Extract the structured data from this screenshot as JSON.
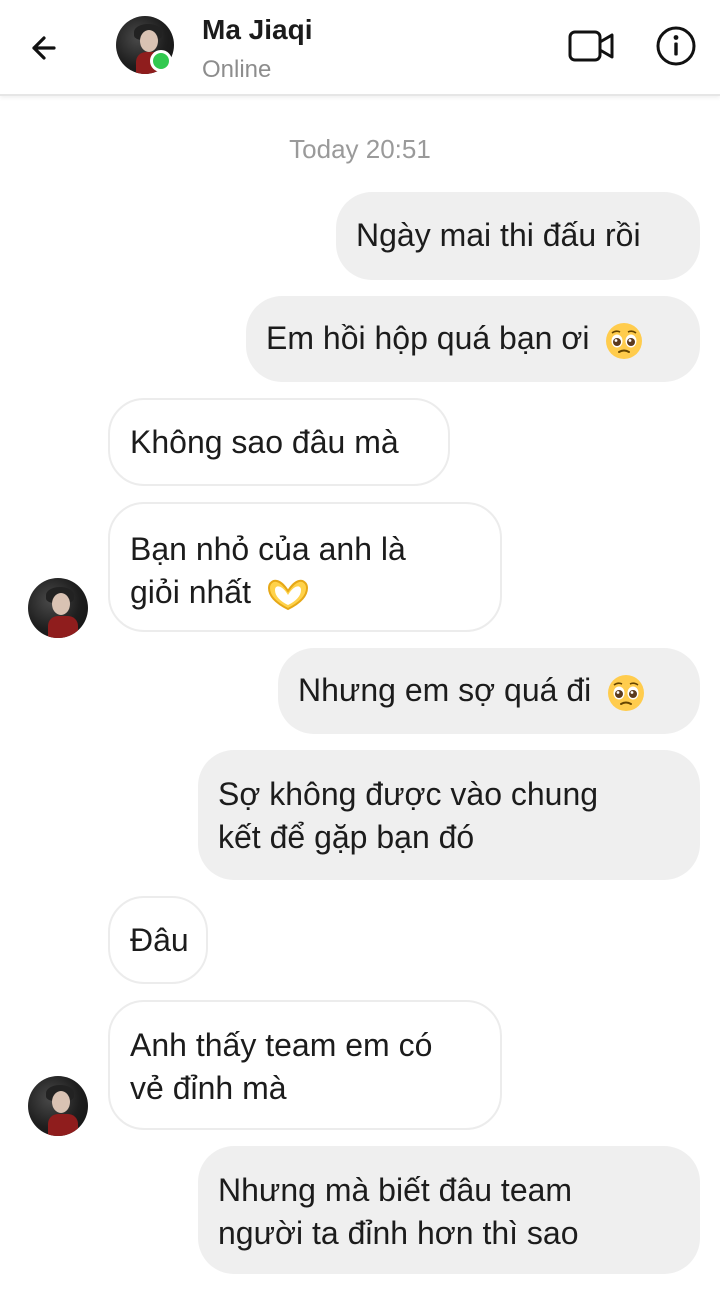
{
  "header": {
    "contact_name": "Ma Jiaqi",
    "status": "Online"
  },
  "conversation": {
    "timestamp": "Today 20:51",
    "messages": [
      {
        "sender": "me",
        "text": "Ngày mai thi đấu rồi",
        "emoji": ""
      },
      {
        "sender": "me",
        "text": "Em hồi hộp quá bạn ơi",
        "emoji": "pleading-face"
      },
      {
        "sender": "them",
        "text": "Không sao đâu mà",
        "emoji": ""
      },
      {
        "sender": "them",
        "line1": "Bạn nhỏ của anh là",
        "line2": "giỏi nhất",
        "emoji": "heart-hands"
      },
      {
        "sender": "me",
        "text": "Nhưng em sợ quá đi",
        "emoji": "pleading-face"
      },
      {
        "sender": "me",
        "line1": "Sợ không được vào chung",
        "line2": "kết để gặp bạn đó",
        "emoji": ""
      },
      {
        "sender": "them",
        "text": "Đâu",
        "emoji": ""
      },
      {
        "sender": "them",
        "line1": "Anh thấy team em có",
        "line2": "vẻ đỉnh mà",
        "emoji": ""
      },
      {
        "sender": "me",
        "line1": "Nhưng mà biết đâu team",
        "line2": "người ta đỉnh hơn thì sao",
        "emoji": ""
      }
    ]
  },
  "colors": {
    "my_bubble": "#efefef",
    "their_bubble_border": "#ececec",
    "online": "#31c94f",
    "timestamp": "#9a9a9a"
  }
}
